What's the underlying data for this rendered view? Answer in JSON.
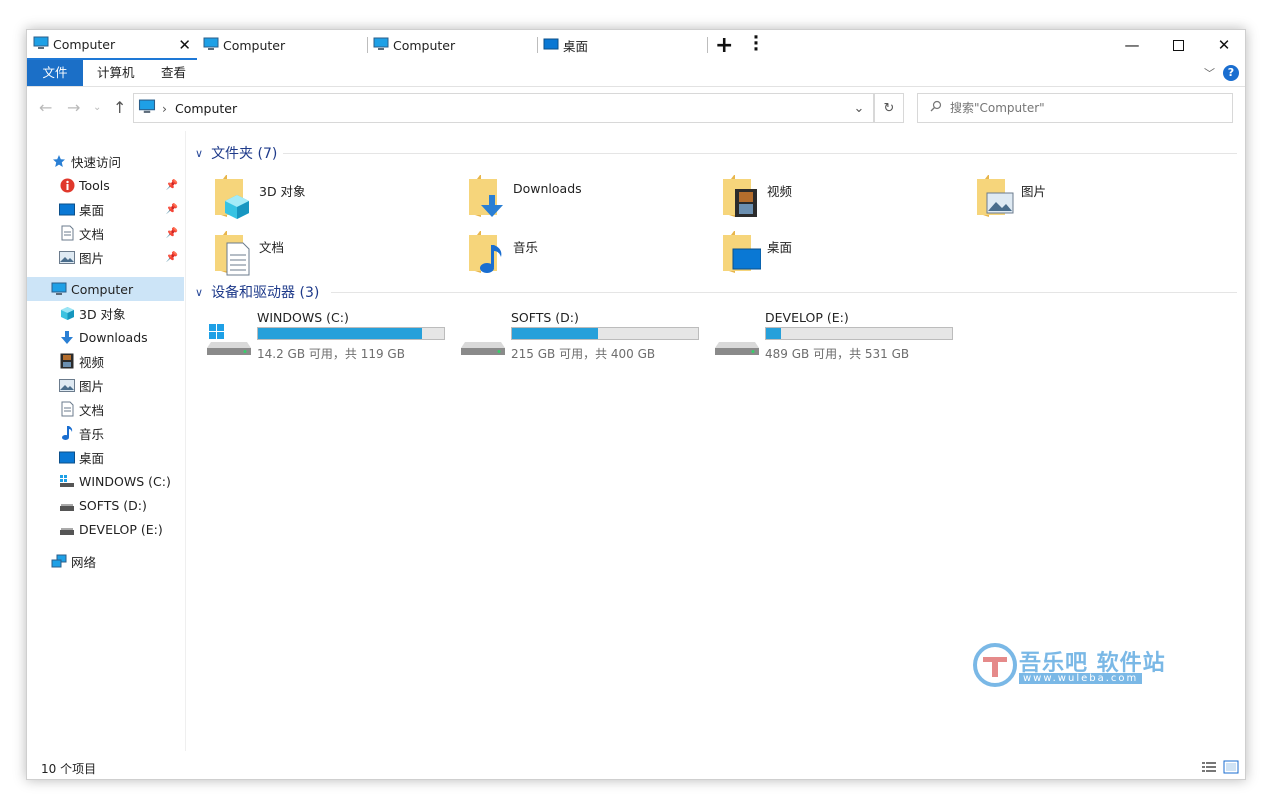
{
  "tabs": [
    {
      "label": "Computer",
      "icon": "monitor-icon"
    },
    {
      "label": "Computer",
      "icon": "monitor-icon"
    },
    {
      "label": "Computer",
      "icon": "monitor-icon"
    },
    {
      "label": "桌面",
      "icon": "desktop-icon"
    }
  ],
  "ribbon": {
    "file": "文件",
    "computer": "计算机",
    "view": "查看"
  },
  "address": {
    "path": "Computer"
  },
  "search": {
    "placeholder": "搜索\"Computer\""
  },
  "sidebar": {
    "quick_access": "快速访问",
    "quick_items": [
      "Tools",
      "桌面",
      "文档",
      "图片"
    ],
    "computer": "Computer",
    "computer_items": [
      "3D 对象",
      "Downloads",
      "视频",
      "图片",
      "文档",
      "音乐",
      "桌面",
      "WINDOWS (C:)",
      "SOFTS (D:)",
      "DEVELOP (E:)"
    ],
    "network": "网络"
  },
  "folders_group": {
    "title": "文件夹 (7)"
  },
  "folders": [
    "3D 对象",
    "Downloads",
    "视频",
    "图片",
    "文档",
    "音乐",
    "桌面"
  ],
  "drives_group": {
    "title": "设备和驱动器 (3)"
  },
  "drives": [
    {
      "label": "WINDOWS (C:)",
      "size": "14.2 GB 可用，共 119 GB",
      "used_fraction": 0.88
    },
    {
      "label": "SOFTS (D:)",
      "size": "215 GB 可用，共 400 GB",
      "used_fraction": 0.46
    },
    {
      "label": "DEVELOP (E:)",
      "size": "489 GB 可用，共 531 GB",
      "used_fraction": 0.08
    }
  ],
  "status": {
    "count": "10 个项目"
  },
  "watermark": {
    "title": "吾乐吧 软件站",
    "url": "www.wuleba.com"
  },
  "colors": {
    "accent": "#1b6fc7",
    "drive_fill": "#26a0da",
    "group_header": "#1e3a8a"
  }
}
